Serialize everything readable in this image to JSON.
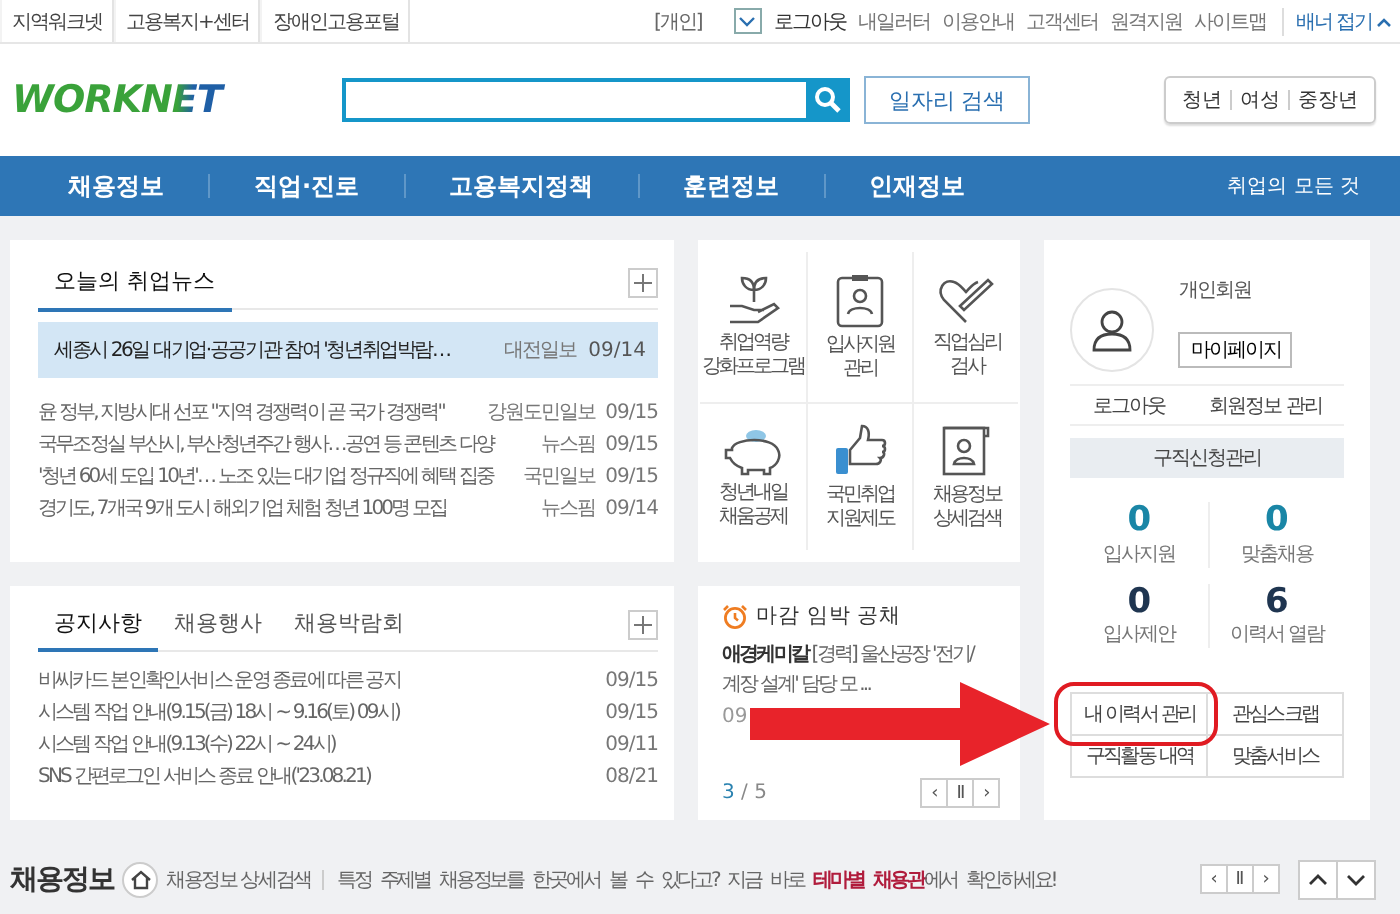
{
  "top_bar": {
    "sites": [
      "지역워크넷",
      "고용복지+센터",
      "장애인고용포털"
    ],
    "member_type": "[개인]",
    "links": [
      "로그아웃",
      "내일러터",
      "이용안내",
      "고객센터",
      "원격지원",
      "사이트맵"
    ],
    "banner_toggle": "배너 접기"
  },
  "header": {
    "logo": "WORKNET",
    "search_button": "일자리 검색",
    "segments": [
      "청년",
      "여성",
      "중장년"
    ]
  },
  "nav": {
    "items": [
      "채용정보",
      "직업·진로",
      "고용복지정책",
      "훈련정보",
      "인재정보"
    ],
    "extra": "취업의 모든 것"
  },
  "news": {
    "title": "오늘의 취업뉴스",
    "featured": {
      "title": "세종시 26일 대기업·공공기관 참여 '청년취업박람…",
      "source": "대전일보",
      "date": "09/14"
    },
    "rows": [
      {
        "title": "윤 정부, 지방시대 선포 \"지역 경쟁력이 곧 국가 경쟁력\"",
        "source": "강원도민일보",
        "date": "09/15"
      },
      {
        "title": "국무조정실 부산시, 부산청년주간 행사…공연 등 콘텐츠 다양",
        "source": "뉴스핌",
        "date": "09/15"
      },
      {
        "title": "'청년 60세 도입 10년'… 노조 있는 대기업 정규직에 혜택 집중",
        "source": "국민일보",
        "date": "09/15"
      },
      {
        "title": "경기도, 7개국 9개 도시 해외기업 체험 청년 100명 모집",
        "source": "뉴스핌",
        "date": "09/14"
      }
    ]
  },
  "notices": {
    "tabs": [
      {
        "label": "공지사항",
        "selected": true
      },
      {
        "label": "채용행사",
        "selected": false
      },
      {
        "label": "채용박람회",
        "selected": false
      }
    ],
    "rows": [
      {
        "title": "비씨카드 본인확인서비스 운영 종료에 따른 공지",
        "date": "09/15"
      },
      {
        "title": "시스템 작업 안내(9.15(금) 18시 ~ 9.16(토) 09시)",
        "date": "09/15"
      },
      {
        "title": "시스템 작업 안내(9.13(수) 22시 ~ 24시)",
        "date": "09/11"
      },
      {
        "title": "SNS 간편로그인 서비스 종료 안내('23.08.21)",
        "date": "08/21"
      }
    ]
  },
  "quick_menu": [
    {
      "kind": "sprout",
      "label": "취업역량 강화프로그램"
    },
    {
      "kind": "badge",
      "label": "입사지원 관리"
    },
    {
      "kind": "heart",
      "label": "직업심리 검사"
    },
    {
      "kind": "piggy",
      "label": "청년내일 채움공제"
    },
    {
      "kind": "thumb",
      "label": "국민취업 지원제도"
    },
    {
      "kind": "scroll",
      "label": "채용정보 상세검색"
    }
  ],
  "deadline": {
    "title": "마감 임박 공채",
    "company": "애경케미칼",
    "text": "[경력] 울산공장 '전기/계장 설계' 담당 모 ...",
    "date": "09",
    "page": "3",
    "total": "/ 5",
    "controls": [
      "‹",
      "Ⅱ",
      "›"
    ]
  },
  "profile": {
    "member": "개인회원",
    "mypage": "마이페이지",
    "links": [
      "로그아웃",
      "회원정보 관리"
    ],
    "apply": "구직신청관리",
    "stats": [
      {
        "value": "0",
        "label": "입사지원",
        "color": "#1a86a6"
      },
      {
        "value": "0",
        "label": "맞춤채용",
        "color": "#1a86a6"
      },
      {
        "value": "0",
        "label": "입사제안",
        "color": "#1f3550"
      },
      {
        "value": "6",
        "label": "이력서 열람",
        "color": "#1f3550"
      }
    ],
    "menu": [
      "내 이력서 관리",
      "관심스크랩",
      "구직활동 내역",
      "맞춤서비스"
    ]
  },
  "bottom": {
    "title": "채용정보",
    "link": "채용정보 상세검색",
    "message": "특정 주제별 채용정보를 한곳에서 볼 수 있다고? 지금 바로 **테마별 채용관**에서 확인하세요!",
    "controls": [
      "‹",
      "Ⅱ",
      "›"
    ]
  }
}
